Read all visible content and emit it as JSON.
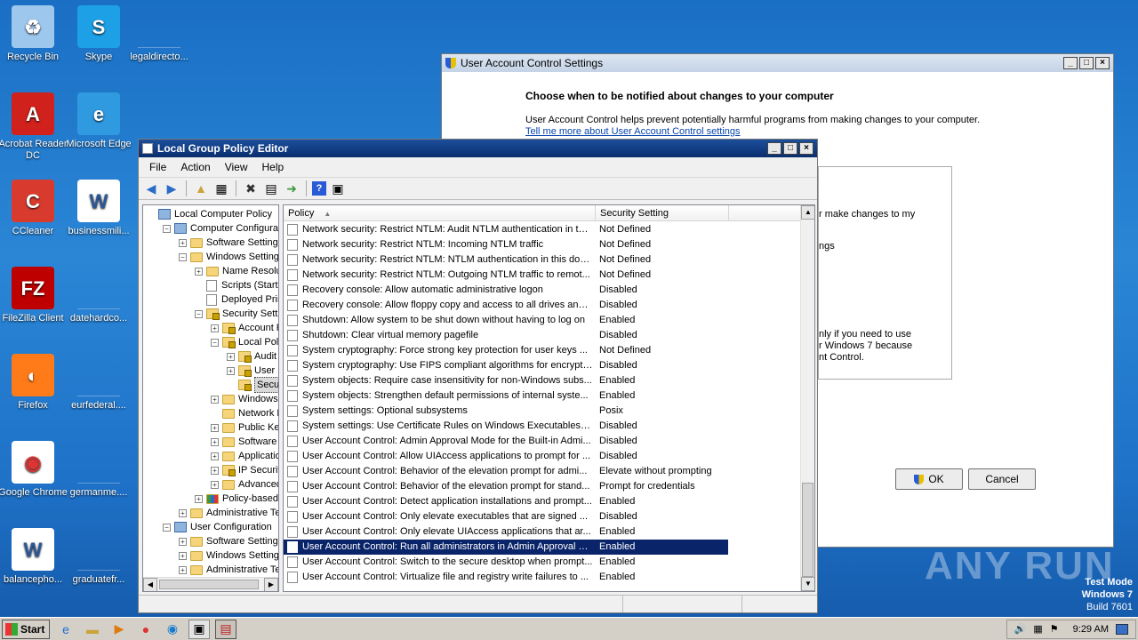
{
  "desktop": {
    "icons": [
      {
        "label": "Recycle Bin",
        "icon": "recycle-bin-icon"
      },
      {
        "label": "Skype",
        "icon": "skype-icon"
      },
      {
        "label": "legaldirecto...",
        "icon": "file-icon"
      },
      {
        "label": "Acrobat Reader DC",
        "icon": "acrobat-icon"
      },
      {
        "label": "Microsoft Edge",
        "icon": "edge-icon"
      },
      {
        "label": "CCleaner",
        "icon": "ccleaner-icon"
      },
      {
        "label": "businessmili...",
        "icon": "word-doc-icon"
      },
      {
        "label": "FileZilla Client",
        "icon": "filezilla-icon"
      },
      {
        "label": "datehardco...",
        "icon": "file-icon"
      },
      {
        "label": "Firefox",
        "icon": "firefox-icon"
      },
      {
        "label": "eurfederal....",
        "icon": "file-icon"
      },
      {
        "label": "Google Chrome",
        "icon": "chrome-icon"
      },
      {
        "label": "germanme....",
        "icon": "file-icon"
      },
      {
        "label": "balancepho...",
        "icon": "word-doc-icon"
      },
      {
        "label": "graduatefr...",
        "icon": "file-icon"
      }
    ],
    "watermark": "ANY RUN",
    "test_mode": {
      "line1": "Test Mode",
      "line2": "Windows 7",
      "line3": "Build 7601"
    }
  },
  "uac": {
    "title": "User Account Control Settings",
    "heading": "Choose when to be notified about changes to your computer",
    "desc": "User Account Control helps prevent potentially harmful programs from making changes to your computer.",
    "link": "Tell me more about User Account Control settings",
    "frag1": "r make changes to my",
    "frag2": "ngs",
    "frag3": "nly if you need to use",
    "frag4": "r Windows 7 because",
    "frag5": "nt Control.",
    "ok": "OK",
    "cancel": "Cancel"
  },
  "gpe": {
    "title": "Local Group Policy Editor",
    "menu": [
      "File",
      "Action",
      "View",
      "Help"
    ],
    "tree": [
      {
        "label": "Local Computer Policy",
        "level": 0,
        "exp": "",
        "icon": "pc"
      },
      {
        "label": "Computer Configuratio",
        "level": 1,
        "exp": "−",
        "icon": "pc"
      },
      {
        "label": "Software Settings",
        "level": 2,
        "exp": "+",
        "icon": "folder"
      },
      {
        "label": "Windows Settings",
        "level": 2,
        "exp": "−",
        "icon": "folder"
      },
      {
        "label": "Name Resolutio",
        "level": 3,
        "exp": "+",
        "icon": "folder"
      },
      {
        "label": "Scripts (Startup",
        "level": 3,
        "exp": "",
        "icon": "doc"
      },
      {
        "label": "Deployed Printe",
        "level": 3,
        "exp": "",
        "icon": "doc"
      },
      {
        "label": "Security Settin",
        "level": 3,
        "exp": "−",
        "icon": "lock"
      },
      {
        "label": "Account Po",
        "level": 4,
        "exp": "+",
        "icon": "lock"
      },
      {
        "label": "Local Policie",
        "level": 4,
        "exp": "−",
        "icon": "lock"
      },
      {
        "label": "Audit P",
        "level": 5,
        "exp": "+",
        "icon": "lock"
      },
      {
        "label": "User Ri",
        "level": 5,
        "exp": "+",
        "icon": "lock"
      },
      {
        "label": "Securit",
        "level": 5,
        "exp": "",
        "icon": "lock",
        "selected": true
      },
      {
        "label": "Windows F",
        "level": 4,
        "exp": "+",
        "icon": "folder"
      },
      {
        "label": "Network Lis",
        "level": 4,
        "exp": "",
        "icon": "folder"
      },
      {
        "label": "Public Key I",
        "level": 4,
        "exp": "+",
        "icon": "folder"
      },
      {
        "label": "Software R",
        "level": 4,
        "exp": "+",
        "icon": "folder"
      },
      {
        "label": "Application",
        "level": 4,
        "exp": "+",
        "icon": "folder"
      },
      {
        "label": "IP Security",
        "level": 4,
        "exp": "+",
        "icon": "lock"
      },
      {
        "label": "Advanced",
        "level": 4,
        "exp": "+",
        "icon": "folder"
      },
      {
        "label": "Policy-based Q",
        "level": 3,
        "exp": "+",
        "icon": "chart"
      },
      {
        "label": "Administrative Tem",
        "level": 2,
        "exp": "+",
        "icon": "folder"
      },
      {
        "label": "User Configuration",
        "level": 1,
        "exp": "−",
        "icon": "pc"
      },
      {
        "label": "Software Settings",
        "level": 2,
        "exp": "+",
        "icon": "folder"
      },
      {
        "label": "Windows Settings",
        "level": 2,
        "exp": "+",
        "icon": "folder"
      },
      {
        "label": "Administrative Tem",
        "level": 2,
        "exp": "+",
        "icon": "folder"
      }
    ],
    "columns": {
      "policy": "Policy",
      "setting": "Security Setting"
    },
    "rows": [
      {
        "policy": "Network security: Restrict NTLM: Audit NTLM authentication in thi...",
        "setting": "Not Defined"
      },
      {
        "policy": "Network security: Restrict NTLM: Incoming NTLM traffic",
        "setting": "Not Defined"
      },
      {
        "policy": "Network security: Restrict NTLM: NTLM authentication in this dom...",
        "setting": "Not Defined"
      },
      {
        "policy": "Network security: Restrict NTLM: Outgoing NTLM traffic to remot...",
        "setting": "Not Defined"
      },
      {
        "policy": "Recovery console: Allow automatic administrative logon",
        "setting": "Disabled"
      },
      {
        "policy": "Recovery console: Allow floppy copy and access to all drives and ...",
        "setting": "Disabled"
      },
      {
        "policy": "Shutdown: Allow system to be shut down without having to log on",
        "setting": "Enabled"
      },
      {
        "policy": "Shutdown: Clear virtual memory pagefile",
        "setting": "Disabled"
      },
      {
        "policy": "System cryptography: Force strong key protection for user keys ...",
        "setting": "Not Defined"
      },
      {
        "policy": "System cryptography: Use FIPS compliant algorithms for encrypti...",
        "setting": "Disabled"
      },
      {
        "policy": "System objects: Require case insensitivity for non-Windows subs...",
        "setting": "Enabled"
      },
      {
        "policy": "System objects: Strengthen default permissions of internal syste...",
        "setting": "Enabled"
      },
      {
        "policy": "System settings: Optional subsystems",
        "setting": "Posix"
      },
      {
        "policy": "System settings: Use Certificate Rules on Windows Executables f...",
        "setting": "Disabled"
      },
      {
        "policy": "User Account Control: Admin Approval Mode for the Built-in Admi...",
        "setting": "Disabled"
      },
      {
        "policy": "User Account Control: Allow UIAccess applications to prompt for ...",
        "setting": "Disabled"
      },
      {
        "policy": "User Account Control: Behavior of the elevation prompt for admi...",
        "setting": "Elevate without prompting"
      },
      {
        "policy": "User Account Control: Behavior of the elevation prompt for stand...",
        "setting": "Prompt for credentials"
      },
      {
        "policy": "User Account Control: Detect application installations and prompt...",
        "setting": "Enabled"
      },
      {
        "policy": "User Account Control: Only elevate executables that are signed ...",
        "setting": "Disabled"
      },
      {
        "policy": "User Account Control: Only elevate UIAccess applications that ar...",
        "setting": "Enabled"
      },
      {
        "policy": "User Account Control: Run all administrators in Admin Approval M...",
        "setting": "Enabled",
        "selected": true
      },
      {
        "policy": "User Account Control: Switch to the secure desktop when prompt...",
        "setting": "Enabled"
      },
      {
        "policy": "User Account Control: Virtualize file and registry write failures to ...",
        "setting": "Enabled"
      }
    ]
  },
  "taskbar": {
    "start": "Start",
    "clock": "9:29 AM",
    "apps": [
      "ie-icon",
      "explorer-icon",
      "media-player-icon",
      "chrome-icon",
      "edge-icon",
      "remote-desktop-icon",
      "group-policy-icon"
    ]
  }
}
